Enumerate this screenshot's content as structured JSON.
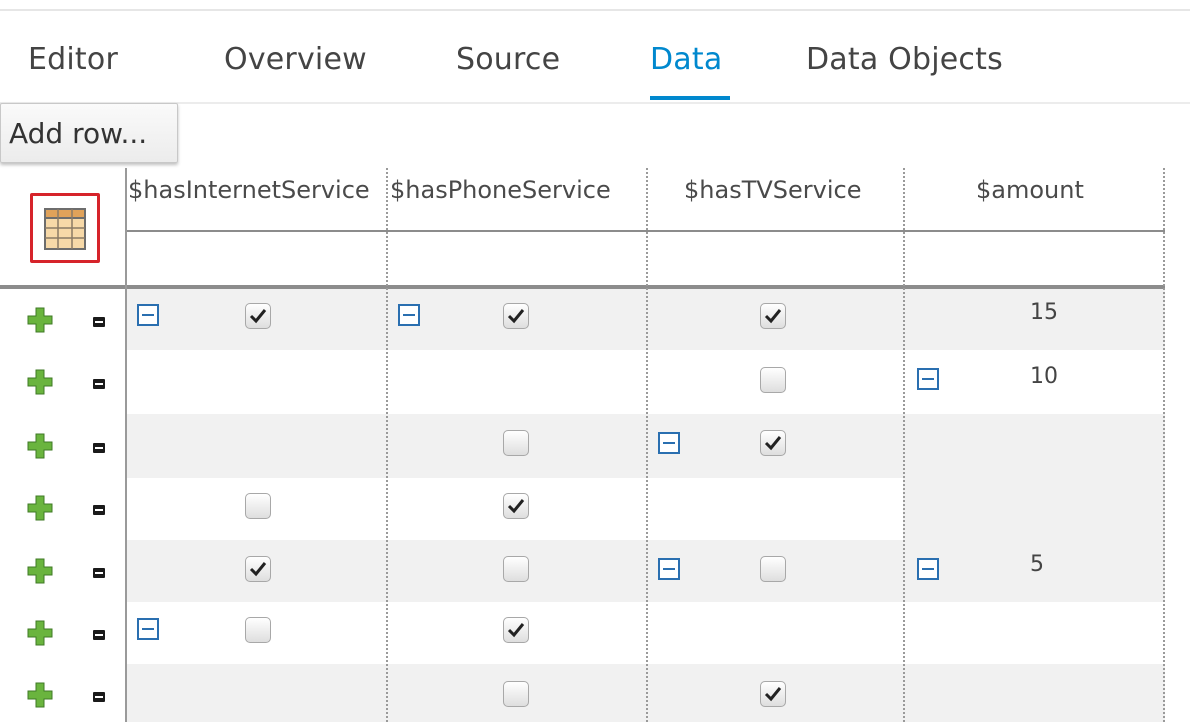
{
  "tabs": [
    {
      "label": "Editor"
    },
    {
      "label": "Overview"
    },
    {
      "label": "Source"
    },
    {
      "label": "Data",
      "active": true
    },
    {
      "label": "Data Objects"
    }
  ],
  "toolbar": {
    "add_row_label": "Add row..."
  },
  "table": {
    "columns": [
      "$hasInternetService",
      "$hasPhoneService",
      "$hasTVService",
      "$amount"
    ],
    "rows": [
      {
        "hasInternetService": true,
        "hasPhoneService": true,
        "hasTVService": true,
        "amount": "15"
      },
      {
        "hasInternetService": null,
        "hasPhoneService": null,
        "hasTVService": false,
        "amount": "10"
      },
      {
        "hasInternetService": null,
        "hasPhoneService": false,
        "hasTVService": true,
        "amount": ""
      },
      {
        "hasInternetService": false,
        "hasPhoneService": true,
        "hasTVService": null,
        "amount": ""
      },
      {
        "hasInternetService": true,
        "hasPhoneService": false,
        "hasTVService": false,
        "amount": "5"
      },
      {
        "hasInternetService": false,
        "hasPhoneService": true,
        "hasTVService": null,
        "amount": ""
      },
      {
        "hasInternetService": null,
        "hasPhoneService": false,
        "hasTVService": true,
        "amount": ""
      }
    ]
  },
  "colors": {
    "accent": "#0088ce",
    "highlight_border": "#d6232a",
    "plus_green": "#6ab43e"
  }
}
